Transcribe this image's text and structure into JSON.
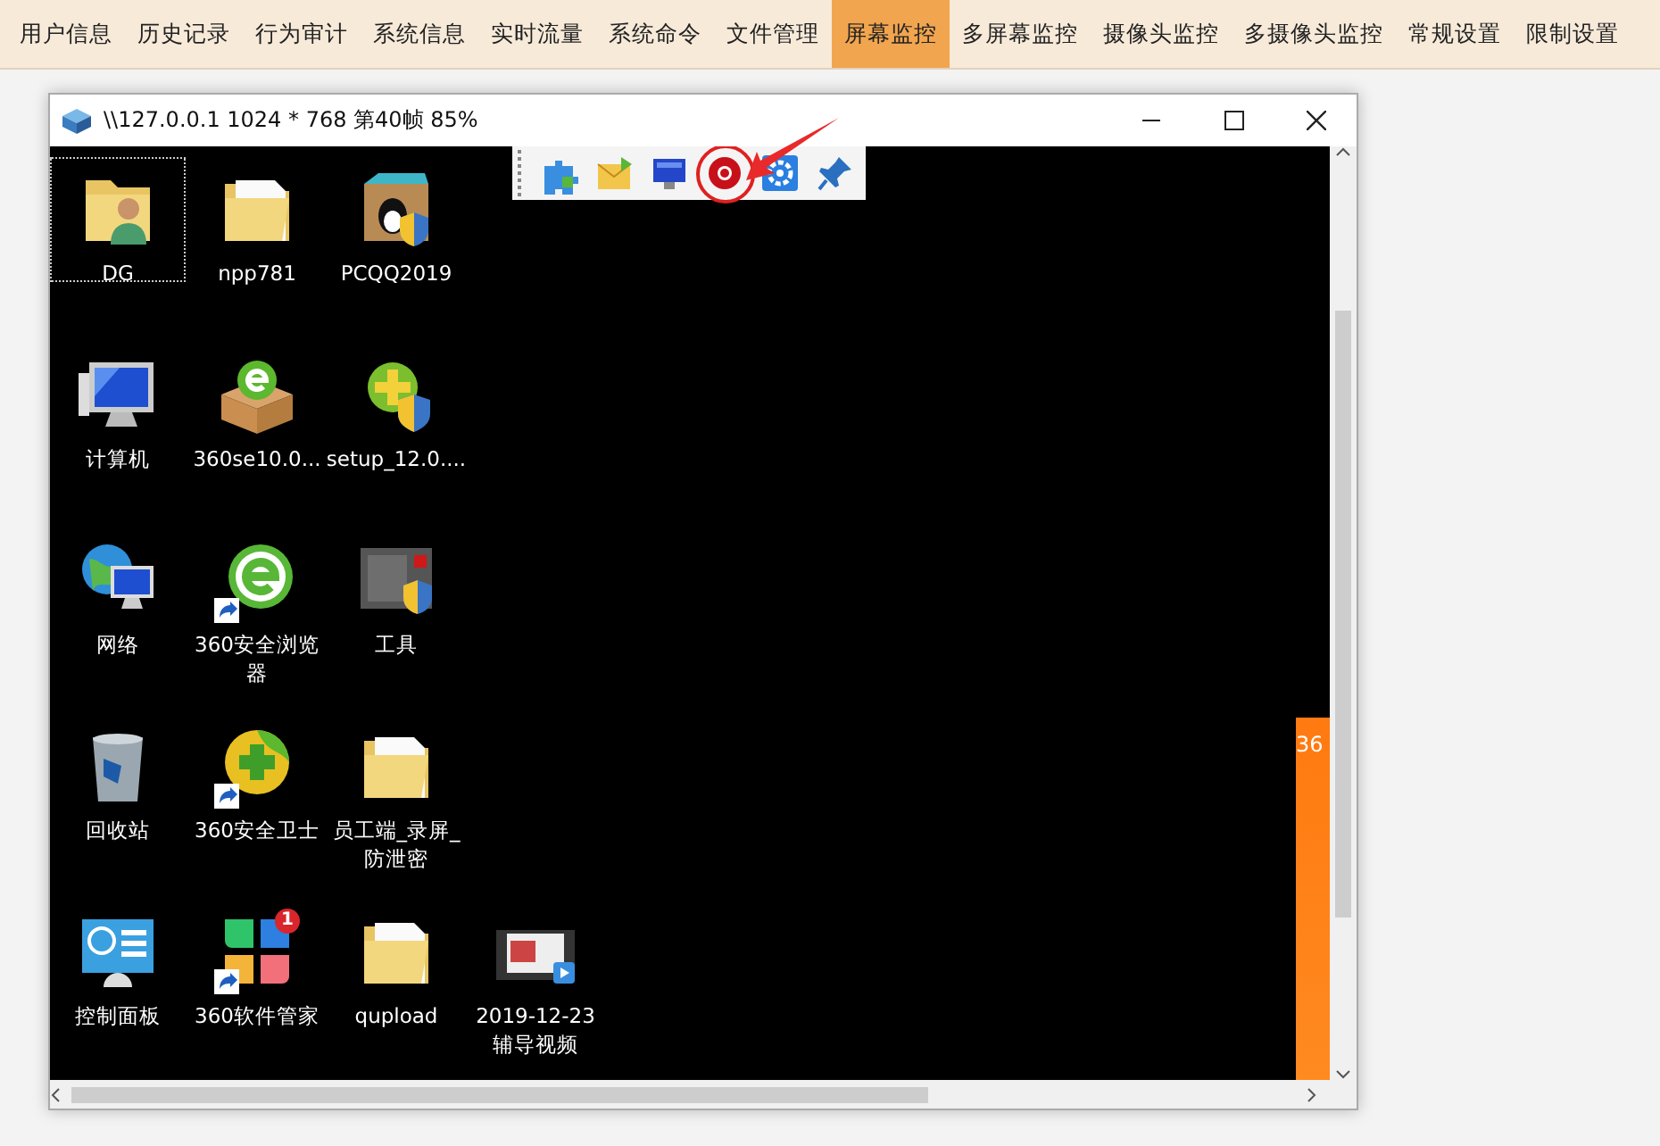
{
  "menu": [
    {
      "label": "用户信息",
      "selected": false
    },
    {
      "label": "历史记录",
      "selected": false
    },
    {
      "label": "行为审计",
      "selected": false
    },
    {
      "label": "系统信息",
      "selected": false
    },
    {
      "label": "实时流量",
      "selected": false
    },
    {
      "label": "系统命令",
      "selected": false
    },
    {
      "label": "文件管理",
      "selected": false
    },
    {
      "label": "屏幕监控",
      "selected": true
    },
    {
      "label": "多屏幕监控",
      "selected": false
    },
    {
      "label": "摄像头监控",
      "selected": false
    },
    {
      "label": "多摄像头监控",
      "selected": false
    },
    {
      "label": "常规设置",
      "selected": false
    },
    {
      "label": "限制设置",
      "selected": false
    }
  ],
  "window": {
    "title": "\\\\127.0.0.1 1024 * 768 第40帧 85%"
  },
  "toolbar": [
    {
      "kind": "puzzle",
      "highlighted": false
    },
    {
      "kind": "mail",
      "highlighted": false
    },
    {
      "kind": "monitor",
      "highlighted": false
    },
    {
      "kind": "lifebuoy",
      "highlighted": true
    },
    {
      "kind": "gear",
      "highlighted": false
    },
    {
      "kind": "pin",
      "highlighted": false
    }
  ],
  "desktop_rows": [
    [
      {
        "label": "DG",
        "kind": "folder-person",
        "shortcut": false,
        "selected": true
      },
      {
        "label": "npp781",
        "kind": "folder",
        "shortcut": false,
        "selected": false
      },
      {
        "label": "PCQQ2019",
        "kind": "box-penguin",
        "shortcut": false,
        "selected": false
      }
    ],
    [
      {
        "label": "计算机",
        "kind": "computer",
        "shortcut": false,
        "selected": false
      },
      {
        "label": "360se10.0...",
        "kind": "box-e",
        "shortcut": false,
        "selected": false
      },
      {
        "label": "setup_12.0....",
        "kind": "plus-shield",
        "shortcut": false,
        "selected": false
      }
    ],
    [
      {
        "label": "网络",
        "kind": "globe",
        "shortcut": false,
        "selected": false
      },
      {
        "label": "360安全浏览器",
        "kind": "e-circle",
        "shortcut": true,
        "selected": false
      },
      {
        "label": "工具",
        "kind": "tools",
        "shortcut": false,
        "selected": false
      }
    ],
    [
      {
        "label": "回收站",
        "kind": "bin",
        "shortcut": false,
        "selected": false
      },
      {
        "label": "360安全卫士",
        "kind": "plus-circle",
        "shortcut": true,
        "selected": false
      },
      {
        "label": "员工端_录屏_防泄密",
        "kind": "folder",
        "shortcut": false,
        "selected": false
      }
    ],
    [
      {
        "label": "控制面板",
        "kind": "control-panel",
        "shortcut": false,
        "selected": false
      },
      {
        "label": "360软件管家",
        "kind": "petals",
        "shortcut": true,
        "selected": false,
        "badge": "1"
      },
      {
        "label": "qupload",
        "kind": "folder",
        "shortcut": false,
        "selected": false
      },
      {
        "label": "2019-12-23 辅导视频",
        "kind": "video",
        "shortcut": false,
        "selected": false
      }
    ]
  ],
  "side_panel": {
    "text": "36"
  }
}
